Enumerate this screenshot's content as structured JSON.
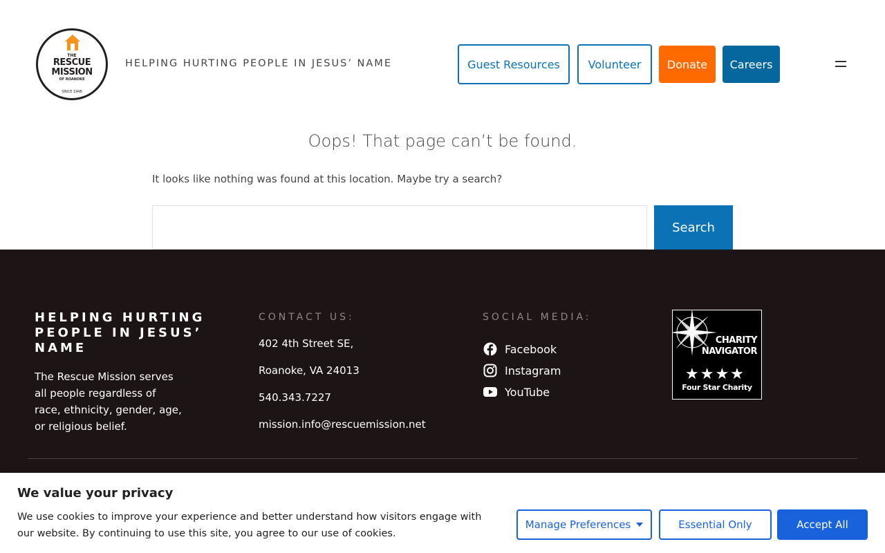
{
  "header": {
    "logo": {
      "line1": "THE",
      "line2": "RESCUE",
      "line3": "MISSION",
      "line4": "OF ROANOKE",
      "line5": "SINCE 1948"
    },
    "tagline": "HELPING HURTING PEOPLE IN JESUS’ NAME",
    "nav": {
      "guest": "Guest Resources",
      "volunteer": "Volunteer",
      "donate": "Donate",
      "careers": "Careers"
    },
    "menu_icon": "hamburger-icon"
  },
  "main": {
    "heading": "Oops! That page can’t be found.",
    "description": "It looks like nothing was found at this location. Maybe try a search?",
    "search": {
      "value": "",
      "placeholder": "",
      "button_label": "Search"
    }
  },
  "footer": {
    "heading": "HELPING HURTING PEOPLE IN JESUS’ NAME",
    "mission": "The Rescue Mission serves all people regardless of race, ethnicity, gender, age, or religious belief.",
    "contact": {
      "label": "CONTACT US:",
      "address1": "402 4th Street SE,",
      "address2": "Roanoke, VA 24013",
      "phone": " 540.343.7227",
      "email": " mission.info@rescuemission.net"
    },
    "social": {
      "label": "SOCIAL MEDIA:",
      "items": [
        {
          "label": "Facebook",
          "icon": "facebook-icon"
        },
        {
          "label": "Instagram",
          "icon": "instagram-icon"
        },
        {
          "label": "YouTube",
          "icon": "youtube-icon"
        }
      ]
    },
    "charity": {
      "line1": "CHARITY",
      "line2": "NAVIGATOR",
      "stars": "★★★★",
      "rating": "Four Star Charity"
    }
  },
  "cookie": {
    "title": "We value your privacy",
    "text": "We use cookies to improve your experience and better understand how visitors engage with our website. By continuing to use this site, you agree to our use of cookies.",
    "manage_label": "Manage Preferences",
    "essential_label": "Essential Only",
    "accept_label": "Accept All"
  },
  "colors": {
    "brand_blue": "#0a72b5",
    "donate_orange": "#ff6a00",
    "careers_blue": "#05679e",
    "footer_bg": "#1d1415",
    "cookie_blue": "#1863dc"
  }
}
